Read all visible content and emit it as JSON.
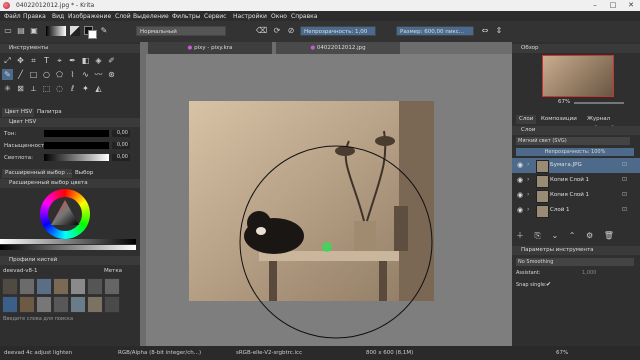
{
  "window": {
    "title": "04022012012.jpg * - Krita",
    "controls": [
      "–",
      "□",
      "✕"
    ]
  },
  "menu": [
    "Файл",
    "Правка",
    "Вид",
    "Изображение",
    "Слой",
    "Выделение",
    "Фильтры",
    "Сервис",
    "Настройки",
    "Окно",
    "Справка"
  ],
  "toolbar": {
    "blend_mode": "Нормальный",
    "opacity_label": "Непрозрачность: 1,00",
    "size_label": "Размер: 600,00 пикс..."
  },
  "left_panel": {
    "tools_header": "Инструменты",
    "color_tabs": [
      "Цвет HSV",
      "Палитра"
    ],
    "hsv_header": "Цвет HSV",
    "sliders": [
      {
        "label": "Тон:",
        "value": "0,00"
      },
      {
        "label": "Насыщенность:",
        "value": "0,00"
      },
      {
        "label": "Светлота:",
        "value": "0,00"
      }
    ],
    "selector_tabs": [
      "Расширенный выбор ...",
      "Выбор определённого ..."
    ],
    "advanced_header": "Расширенный выбор цвета",
    "presets_header": "Профили кистей",
    "preset_tag": "deevad-v8-1",
    "preset_filter": "Метка",
    "search_placeholder": "Введите слова для поиска"
  },
  "document_tabs": [
    "pixy - pixy.kra",
    "04022012012.jpg"
  ],
  "right_panel": {
    "overview_header": "Обзор",
    "zoom": "67%",
    "layer_tabs": [
      "Слои",
      "Композиции",
      "Журнал действий"
    ],
    "layers_header": "Слои",
    "layer_blend": "Мягкий свет (SVG)",
    "layer_opacity": "Непрозрачность: 100%",
    "layers": [
      {
        "name": "Бумага.JPG"
      },
      {
        "name": "Копия  Слой 1"
      },
      {
        "name": "Копия  Слой 1"
      },
      {
        "name": "Слой 1"
      }
    ],
    "tool_options_header": "Параметры инструмента",
    "smoothing": "No Smoothing",
    "assistant_label": "Assistant:",
    "assistant_value": "1,000",
    "snap_label": "Snap single:"
  },
  "status": {
    "brush": "deevad 4c adjust lighten",
    "colorspace": "RGB/Alpha (8-bit integer/ch...)",
    "profile": "sRGB-elle-V2-srgbtrc.icc",
    "size": "800 x 600 (8,1M)",
    "zoom": "67%"
  },
  "colors": {
    "accent": "#4d6a8b",
    "panel": "#2f2f2f",
    "canvas_bg": "#7e7e7e"
  }
}
